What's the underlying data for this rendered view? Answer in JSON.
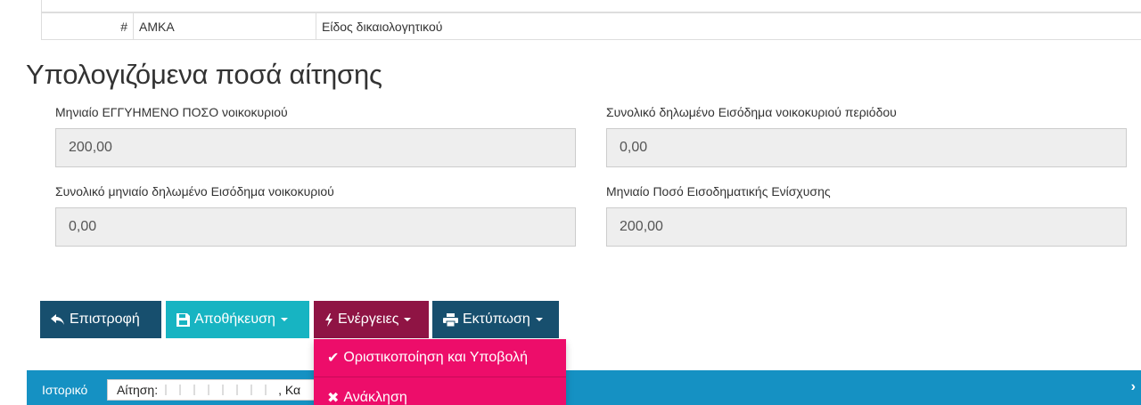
{
  "doc_table": {
    "col_num": "#",
    "col_amka": "ΑΜΚΑ",
    "col_type": "Είδος δικαιολογητικού"
  },
  "section_title": "Υπολογιζόμενα ποσά αίτησης",
  "fields": {
    "guaranteed": {
      "label": "Μηνιαίο ΕΓΓΥΗΜΕΝΟ ΠΟΣΟ νοικοκυριού",
      "value": "200,00"
    },
    "total_period_income": {
      "label": "Συνολικό δηλωμένο Εισόδημα νοικοκυριού περιόδου",
      "value": "0,00"
    },
    "monthly_income": {
      "label": "Συνολικό μηνιαίο δηλωμένο Εισόδημα νοικοκυριού",
      "value": "0,00"
    },
    "support": {
      "label": "Μηνιαίο Ποσό Εισοδηματικής Ενίσχυσης",
      "value": "200,00"
    }
  },
  "buttons": {
    "back": "Επιστροφή",
    "save": "Αποθήκευση",
    "actions": "Ενέργειες",
    "print": "Εκτύπωση"
  },
  "actions_menu": {
    "finalize": "Οριστικοποίηση και Υποβολή",
    "revoke": "Ανάκληση"
  },
  "history": {
    "label": "Ιστορικό",
    "select_prefix": "Αίτηση:",
    "select_suffix": ", Κα"
  },
  "icons": {
    "back": "reply-icon",
    "save": "floppy-icon",
    "actions": "bolt-icon",
    "print": "printer-icon",
    "finalize": "check-icon",
    "revoke": "times-icon",
    "history_next": "chevron-right-icon"
  },
  "colors": {
    "dark_blue": "#174f6e",
    "teal": "#17b4c2",
    "maroon": "#8f1444",
    "pink": "#ed0d6a",
    "history_blue": "#1591c3"
  }
}
